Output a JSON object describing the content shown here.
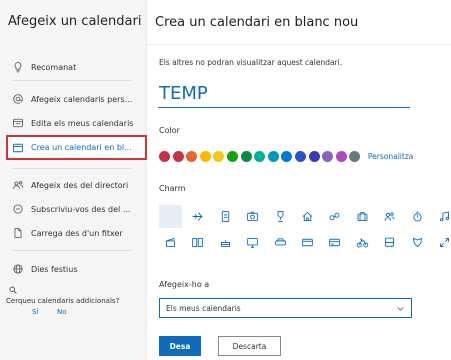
{
  "sidebar": {
    "title": "Afegeix un calendari",
    "items": [
      {
        "label": "Recomanat",
        "icon": "lightbulb-icon"
      },
      {
        "label": "Afegeix calendaris pers...",
        "icon": "at-icon"
      },
      {
        "label": "Edita els meus calendaris",
        "icon": "edit-calendar-icon"
      },
      {
        "label": "Crea un calendari en bl...",
        "icon": "calendar-icon",
        "selected": true
      },
      {
        "label": "Afegeix des del directori",
        "icon": "people-icon"
      },
      {
        "label": "Subscriviu-vos des del ...",
        "icon": "subscribe-icon"
      },
      {
        "label": "Carrega des d'un fitxer",
        "icon": "file-icon"
      },
      {
        "label": "Dies festius",
        "icon": "globe-icon"
      }
    ],
    "question": "Cerqueu calendaris addicionals?",
    "yes": "Sí",
    "no": "No",
    "accent_color": "#d13438"
  },
  "main": {
    "title": "Crea un calendari en blanc nou",
    "description": "Els altres no podran visualitzar aquest calendari.",
    "name_value": "TEMP",
    "color_label": "Color",
    "colors": [
      "#c4314b",
      "#c4314b",
      "#e8632d",
      "#ffb900",
      "#f2c811",
      "#13a10e",
      "#10893e",
      "#00b294",
      "#0099bc",
      "#0078d4",
      "#2b50c8",
      "#3b3ab8",
      "#8764b8",
      "#b146c2",
      "#69797e"
    ],
    "color_more": "Personalitza",
    "charm_label": "Charm",
    "charms_row1": [
      "blank",
      "airplane-icon",
      "document-icon",
      "camera-icon",
      "trophy-icon",
      "home-icon",
      "link-icon",
      "suitcase-icon",
      "people-icon",
      "stopwatch-icon",
      "music-icon"
    ],
    "charms_row2": [
      "movie-icon",
      "book-icon",
      "cake-icon",
      "monitor-icon",
      "car-icon",
      "shopping-cart-icon",
      "card-icon",
      "bike-icon",
      "bus-icon",
      "medal-icon",
      "expand-icon"
    ],
    "add_to_label": "Afegeix-ho a",
    "add_to_value": "Els meus calendaris",
    "save_label": "Desa",
    "cancel_label": "Descarta",
    "brand_color": "#0f6cbd"
  }
}
